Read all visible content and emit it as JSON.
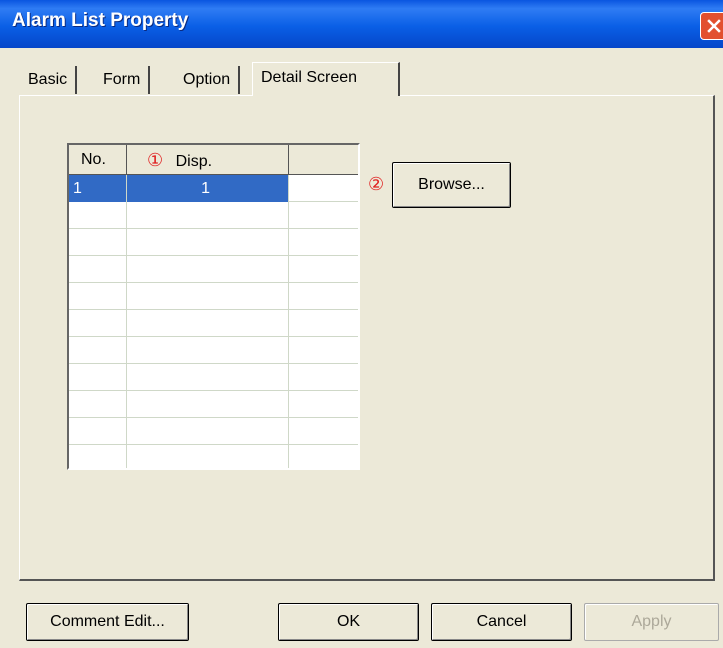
{
  "window": {
    "title": "Alarm List Property"
  },
  "tabs": [
    {
      "label": "Basic"
    },
    {
      "label": "Form"
    },
    {
      "label": "Option"
    },
    {
      "label": "Detail Screen",
      "active": true
    }
  ],
  "grid": {
    "headers": {
      "no": "No.",
      "disp_marker": "①",
      "disp": "Disp.",
      "extra": ""
    },
    "rows": [
      {
        "no": "1",
        "disp": "1",
        "selected": true
      }
    ],
    "empty_rows": 10
  },
  "browse": {
    "marker": "②",
    "label": "Browse..."
  },
  "footer": {
    "comment_edit": "Comment Edit...",
    "ok": "OK",
    "cancel": "Cancel",
    "apply": "Apply"
  },
  "colors": {
    "title_bar": "#0a5fe6",
    "selection": "#316ac5",
    "marker": "#e02020",
    "face": "#ece9d8"
  }
}
